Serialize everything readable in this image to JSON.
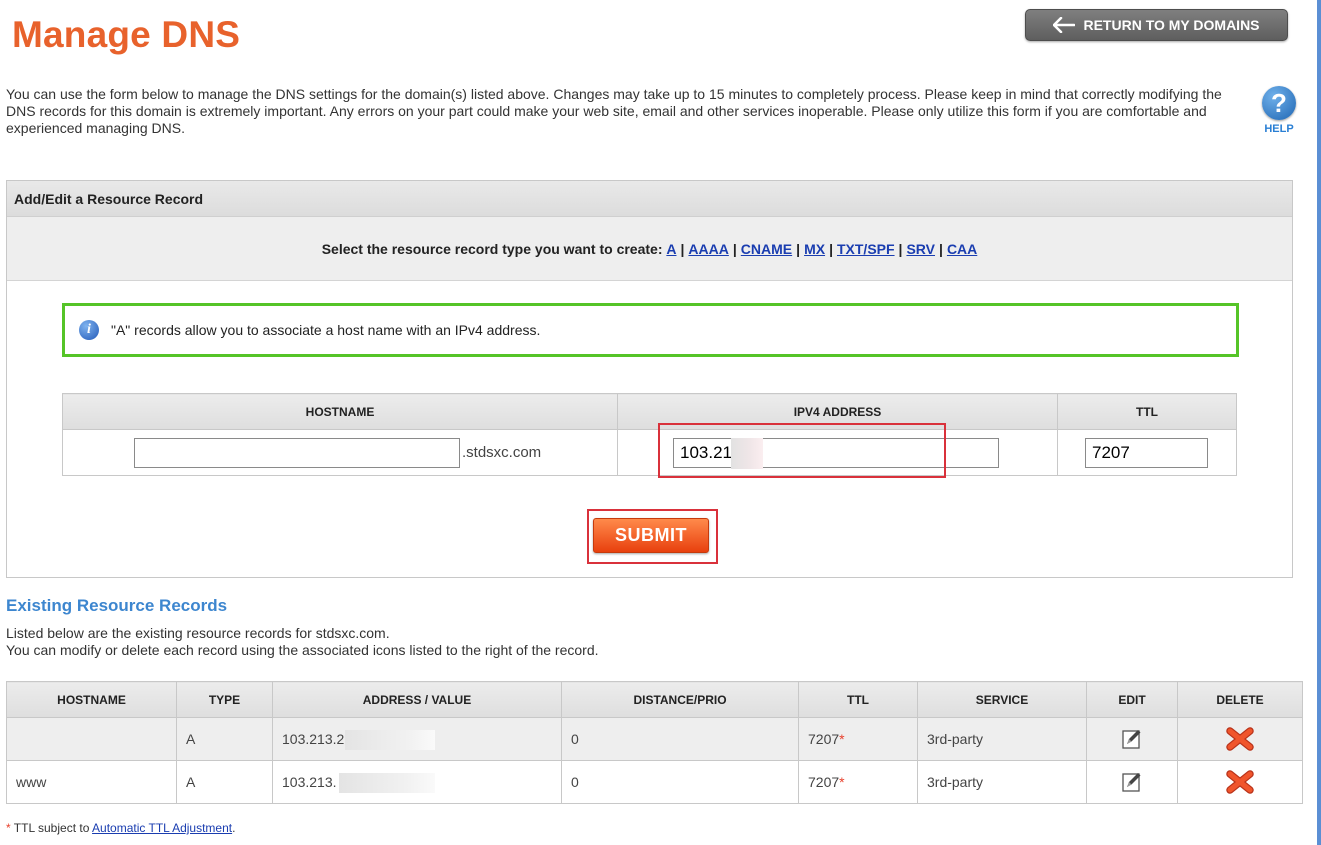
{
  "page": {
    "title": "Manage DNS"
  },
  "header": {
    "return_label": "RETURN TO MY DOMAINS"
  },
  "intro": {
    "text": "You can use the form below to manage the DNS settings for the domain(s) listed above. Changes may take up to 15 minutes to completely process. Please keep in mind that correctly modifying the DNS records for this domain is extremely important. Any errors on your part could make your web site, email and other services inoperable. Please only utilize this form if you are comfortable and experienced managing DNS."
  },
  "help": {
    "label": "HELP",
    "glyph": "?"
  },
  "form": {
    "header": "Add/Edit a Resource Record",
    "select_prompt": "Select the resource record type you want to create:",
    "record_types": [
      "A",
      "AAAA",
      "CNAME",
      "MX",
      "TXT/SPF",
      "SRV",
      "CAA"
    ],
    "info_text": "\"A\" records allow you to associate a host name with an IPv4 address.",
    "columns": {
      "hostname": "HOSTNAME",
      "ipv4": "IPV4 ADDRESS",
      "ttl": "TTL"
    },
    "hostname_value": "",
    "domain_suffix": ".stdsxc.com",
    "ipv4_value": "103.213.2․",
    "ttl_value": "7207",
    "submit_label": "SUBMIT"
  },
  "existing": {
    "title": "Existing Resource Records",
    "desc_line1": "Listed below are the existing resource records for stdsxc.com.",
    "desc_line2": "You can modify or delete each record using the associated icons listed to the right of the record.",
    "columns": {
      "hostname": "HOSTNAME",
      "type": "TYPE",
      "address": "ADDRESS / VALUE",
      "distance": "DISTANCE/PRIO",
      "ttl": "TTL",
      "service": "SERVICE",
      "edit": "EDIT",
      "delete": "DELETE"
    },
    "rows": [
      {
        "hostname": "",
        "type": "A",
        "address": "103.213.2",
        "distance": "0",
        "ttl": "7207",
        "ttl_mark": "*",
        "service": "3rd-party"
      },
      {
        "hostname": "www",
        "type": "A",
        "address": "103.213.",
        "distance": "0",
        "ttl": "7207",
        "ttl_mark": "*",
        "service": "3rd-party"
      }
    ]
  },
  "footnote": {
    "mark": "*",
    "prefix": " TTL subject to ",
    "link": "Automatic TTL Adjustment",
    "suffix": "."
  },
  "colors": {
    "title": "#e8622c",
    "accent": "#3d86cf",
    "info_border": "#55c428",
    "highlight": "#d9313b",
    "submit": "#f05a1e"
  },
  "icons": {
    "return": "arrow-left-icon",
    "help": "question-icon",
    "info": "info-icon",
    "edit": "pencil-edit-icon",
    "delete": "x-delete-icon"
  }
}
